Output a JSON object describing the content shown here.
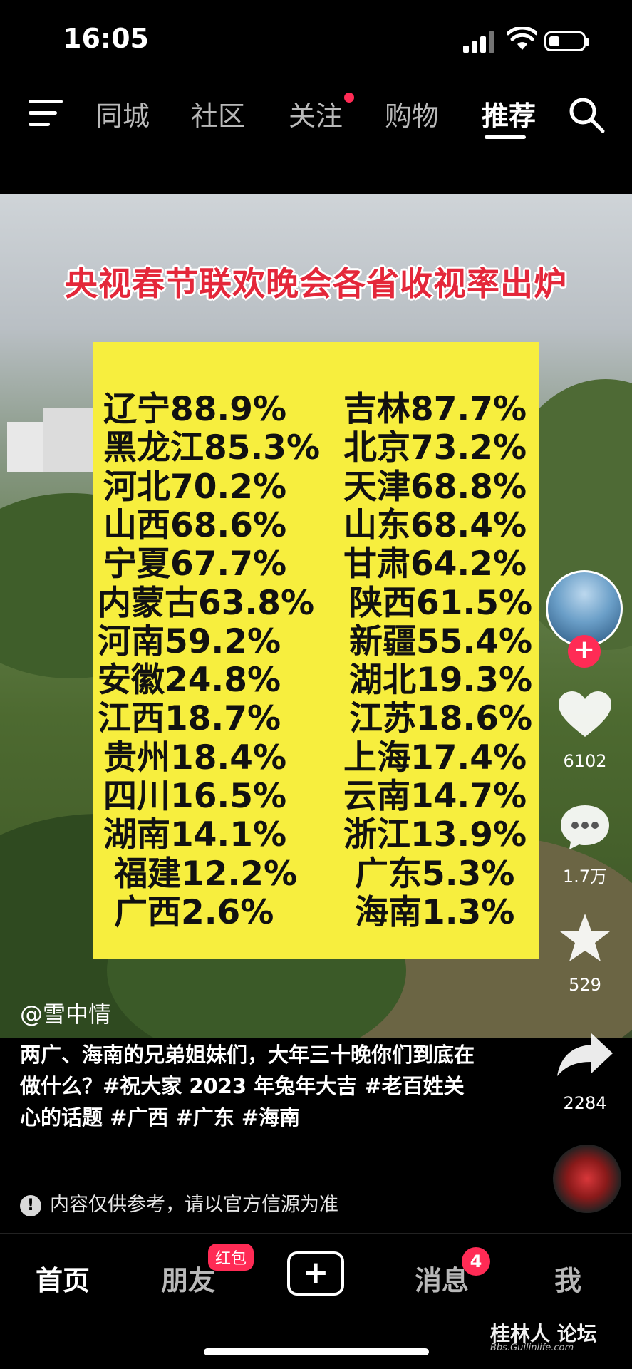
{
  "status_bar": {
    "time": "16:05"
  },
  "top_nav": {
    "tabs": [
      {
        "label": "同城"
      },
      {
        "label": "社区"
      },
      {
        "label": "关注",
        "has_dot": true
      },
      {
        "label": "购物"
      },
      {
        "label": "推荐",
        "active": true
      }
    ],
    "search_icon": "search-icon",
    "menu_icon": "menu-icon"
  },
  "video": {
    "title": "央视春节联欢晚会各省收视率出炉",
    "left_column": [
      "辽宁88.9%",
      "黑龙江85.3%",
      "河北70.2%",
      "山西68.6%",
      "宁夏67.7%",
      "内蒙古63.8%",
      "河南59.2%",
      "安徽24.8%",
      "江西18.7%",
      "贵州18.4%",
      "四川16.5%",
      "湖南14.1%",
      "福建12.2%",
      "广西2.6%"
    ],
    "right_column": [
      "吉林87.7%",
      "北京73.2%",
      "天津68.8%",
      "山东68.4%",
      "甘肃64.2%",
      "陕西61.5%",
      "新疆55.4%",
      "湖北19.3%",
      "江苏18.6%",
      "上海17.4%",
      "云南14.7%",
      "浙江13.9%",
      "广东5.3%",
      "海南1.3%"
    ],
    "author": "@雪中情"
  },
  "right_rail": {
    "likes": "6102",
    "comments": "1.7万",
    "favorites": "529",
    "shares": "2284"
  },
  "caption": {
    "text": "两广、海南的兄弟姐妹们，大年三十晚你们到底在做什么？#祝大家 2023 年兔年大吉 #老百姓关心的话题 #广西 #广东 #海南",
    "notice": "内容仅供参考，请以官方信源为准",
    "notice_icon": "!"
  },
  "bottom_nav": {
    "home": "首页",
    "friends": "朋友",
    "friends_badge": "红包",
    "add": "+",
    "messages": "消息",
    "messages_badge": "4",
    "me": "我"
  },
  "watermark": {
    "main": "桂林人 论坛",
    "sub": "Bbs.Guilinlife.com"
  },
  "colors": {
    "accent": "#ff2b55",
    "board": "#f7ee3e",
    "title_red": "#e4273a"
  }
}
